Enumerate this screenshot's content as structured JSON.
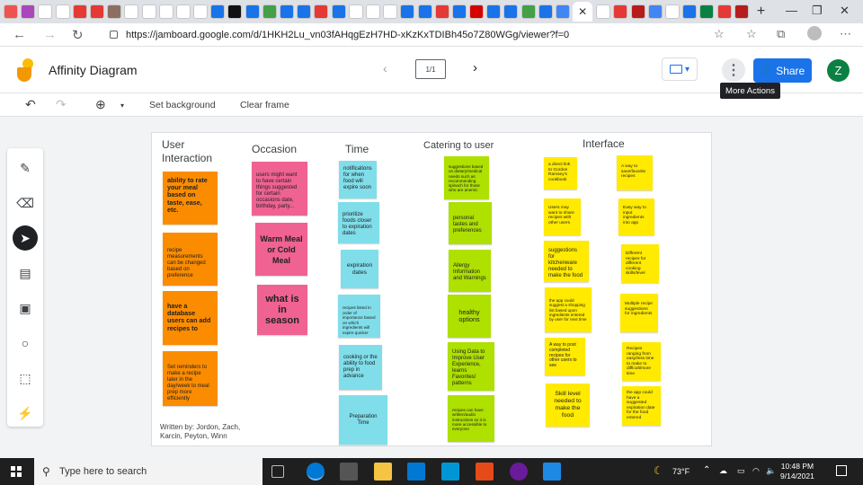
{
  "browser": {
    "url": "https://jamboard.google.com/d/1HKH2Lu_vn03fAHqgEzH7HD-xKzKxTDIBh45o7Z80WGg/viewer?f=0",
    "tab_colors": [
      "#ef5350",
      "#ab47bc",
      "#fff",
      "#fff",
      "#e53935",
      "#e53935",
      "#8d6e63",
      "#fff",
      "#fff",
      "#fff",
      "#fff",
      "#fff",
      "#1a73e8",
      "#111",
      "#1a73e8",
      "#43a047",
      "#1a73e8",
      "#1a73e8",
      "#e53935",
      "#1a73e8",
      "#fff",
      "#fff",
      "#fff",
      "#1a73e8",
      "#1a73e8",
      "#e53935",
      "#1a73e8",
      "#d50000",
      "#1a73e8",
      "#1a73e8",
      "#43a047",
      "#1a73e8",
      "#4285f4"
    ],
    "tab_colors_right": [
      "#fff",
      "#e53935",
      "#b71c1c",
      "#4285f4",
      "#fff",
      "#1a73e8",
      "#0b8043",
      "#e53935",
      "#b71c1c"
    ]
  },
  "app": {
    "title": "Affinity Diagram",
    "frame_counter": "1/1",
    "share_label": "Share",
    "avatar_initial": "Z",
    "more_actions_tooltip": "More Actions"
  },
  "toolbar": {
    "set_background": "Set background",
    "clear_frame": "Clear frame"
  },
  "board": {
    "headers": {
      "user_interaction": "User Interaction",
      "occasion": "Occasion",
      "time": "Time",
      "catering": "Catering to user",
      "interface": "Interface"
    },
    "user_interaction_notes": [
      "ability to rate your meal based on taste, ease, etc.",
      "recipe measurements can be changed based on preference",
      "have a database users can add recipes to",
      "Set reminders to make a recipe later in the day/week to meal prep more efficiently"
    ],
    "occasion_notes": [
      "users might want to have certain things suggested for certain occasions date, birthday, party...",
      "Warm Meal or Cold Meal",
      "what is in season"
    ],
    "time_notes": [
      "notifications for when food will expire soon",
      "prioritize foods closer to expiration dates",
      "expiration dates",
      "recipes listed in order of importance based on which ingredients will expire quicker",
      "cooking or the ability to food prep in advance",
      "Preparation Time"
    ],
    "catering_notes": [
      "suggestions based on dietary/medical needs such as recommending spinach for those who are anemic",
      "personal tastes and preferences",
      "Allergy Information and Warnings",
      "healthy options",
      "Using Data to Improve User Experience, learns Favorites/ patterns",
      "recipes can have written/audio instructions so it is more accessible to everyone"
    ],
    "interface_left_notes": [
      "a direct link to Gordon Ramsey's cookbook",
      "Users may want to share recipes with other users",
      "suggestions for kitchenware needed to make the food",
      "the app could suggest a shopping list based upon ingredients entered by user for next time",
      "A way to post completed recipes for other users to see",
      "Skill level needed to make the food"
    ],
    "interface_right_notes": [
      "A way to save/favorite recipes",
      "Easy way to input ingredients into app",
      "Different recipes for different cooking skills/level",
      "Multiple recipe suggestions for ingredients",
      "Recipes ranging from easy/less time to make to difficult/more time",
      "the app could have a suggested expiration date for the food entered"
    ],
    "credit": "Written by: Jordon, Zach, Karcin, Peyton, Winn"
  },
  "taskbar": {
    "search_placeholder": "Type here to search",
    "weather": "73°F",
    "time": "10:48 PM",
    "date": "9/14/2021"
  }
}
